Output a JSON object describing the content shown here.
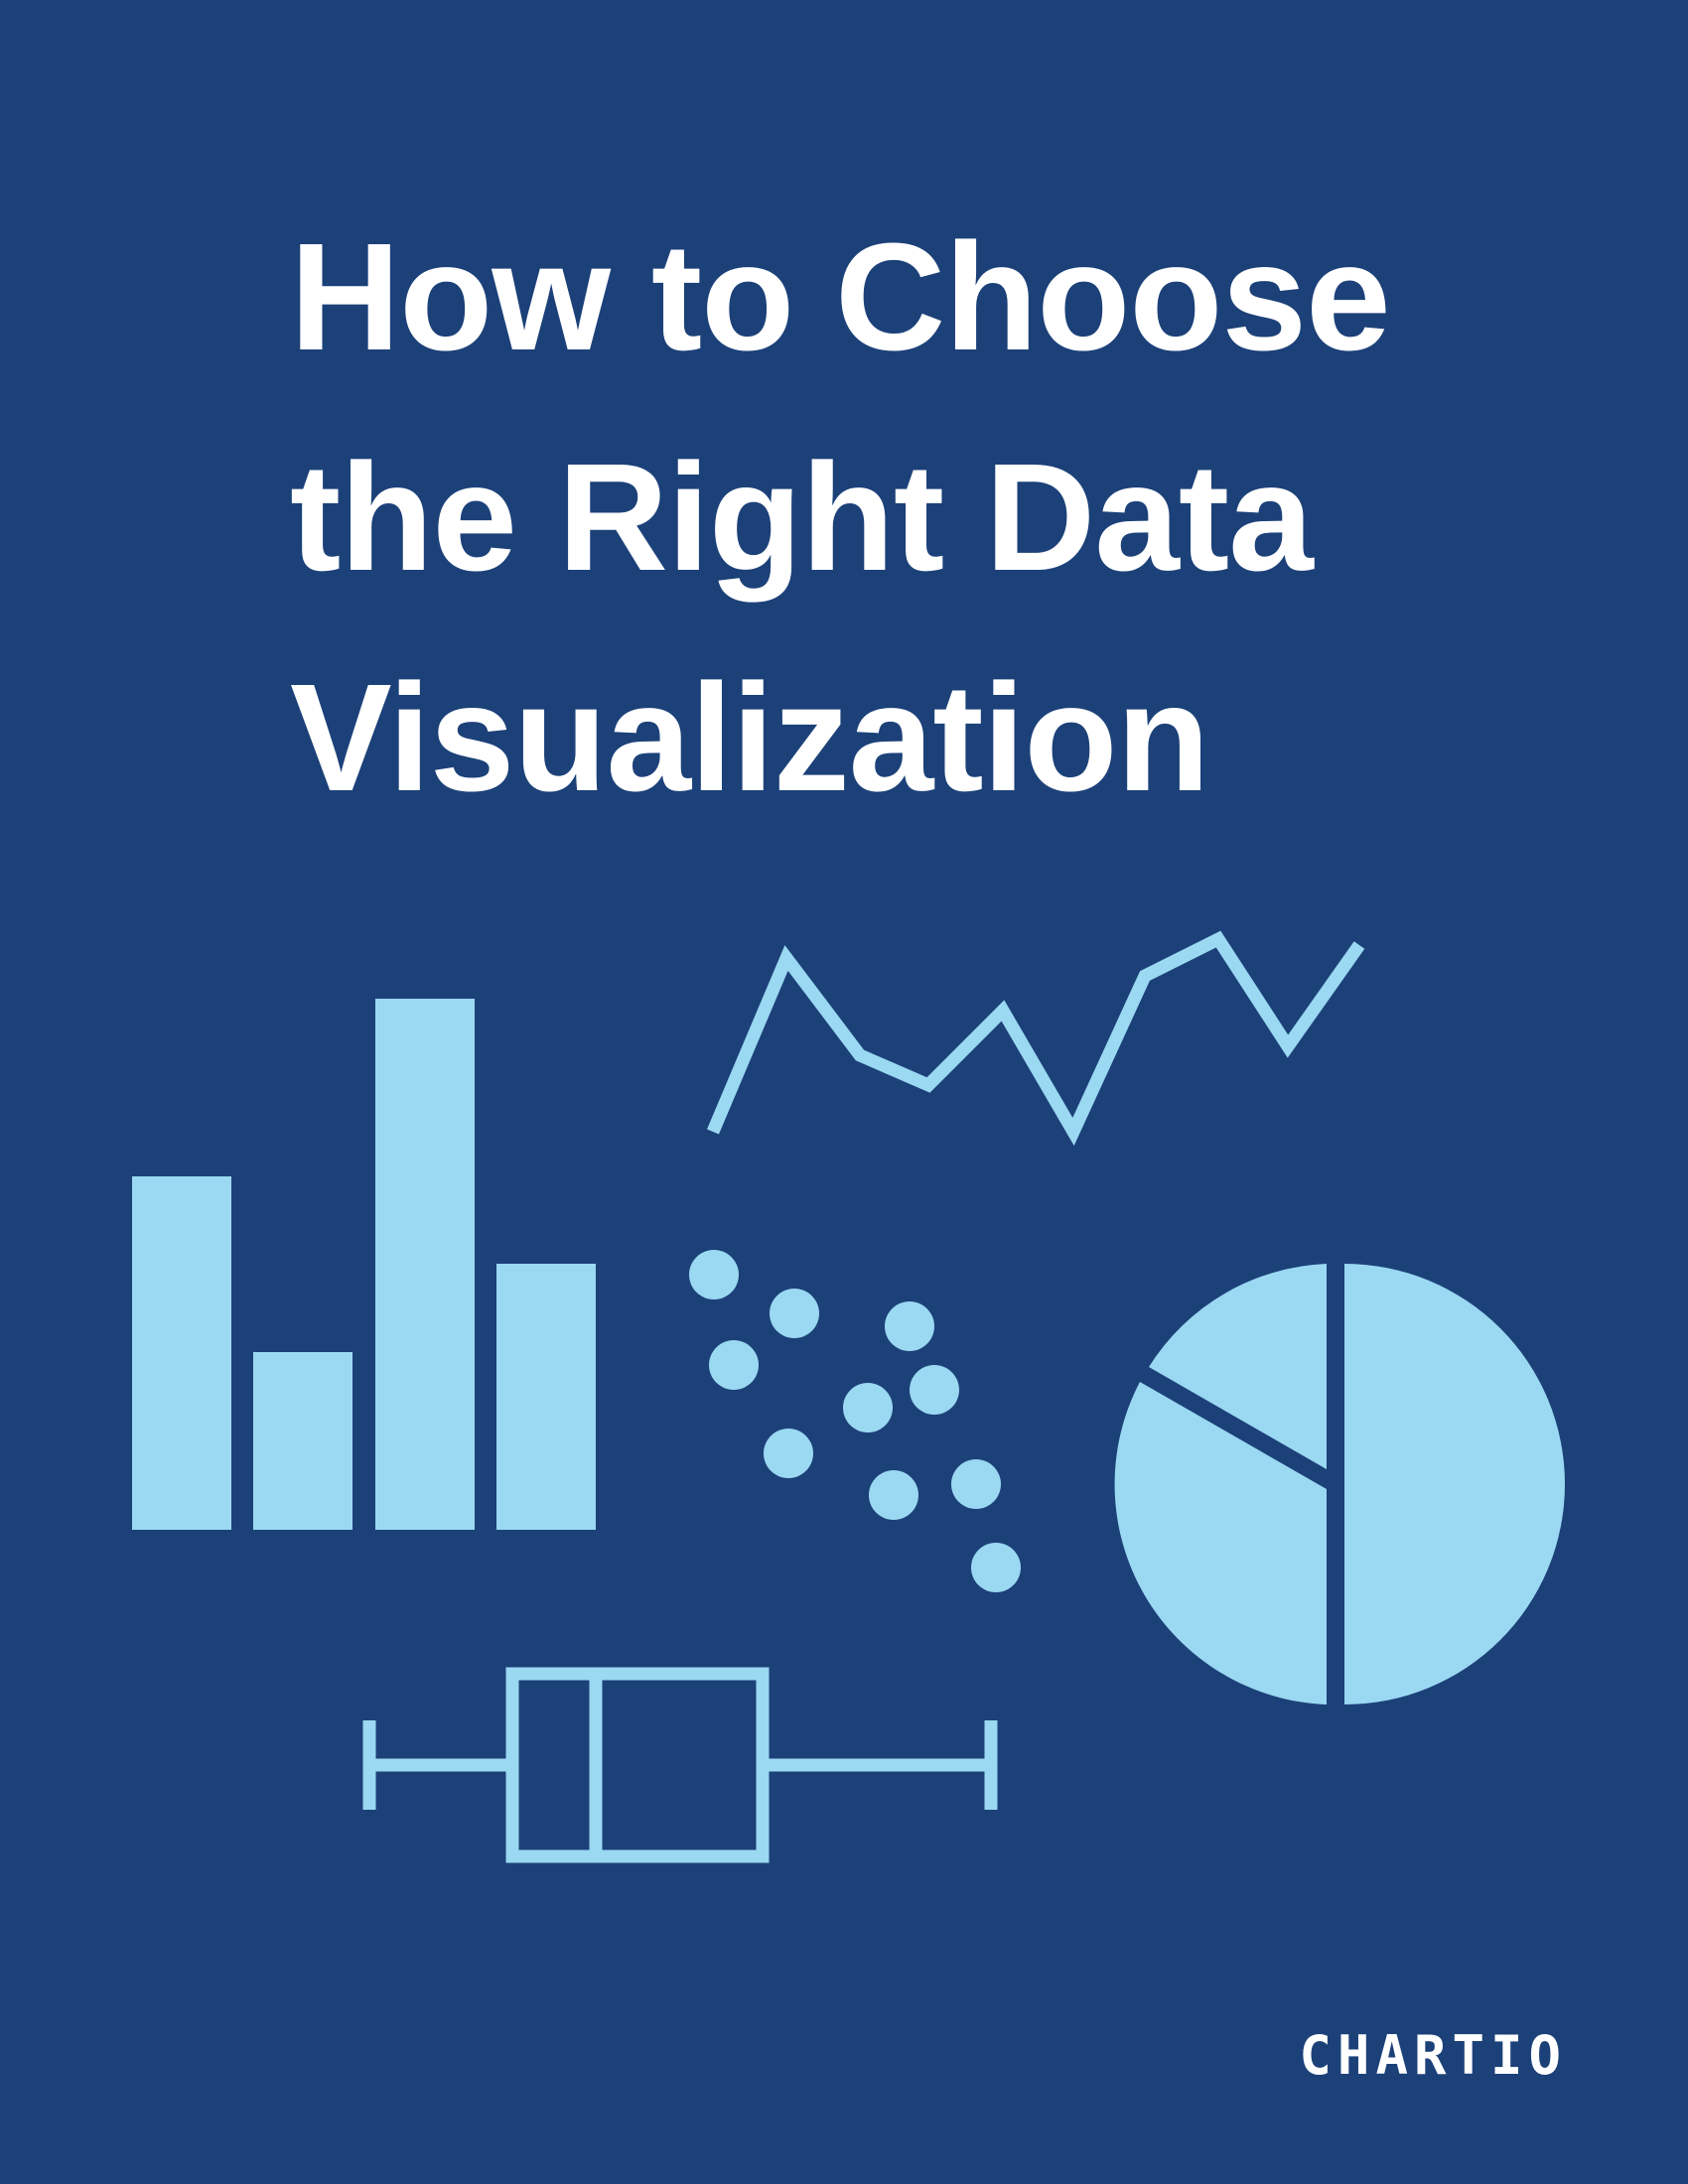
{
  "cover": {
    "title_lines": [
      "How to Choose",
      "the Right Data",
      "Visualization"
    ],
    "brand": "CHARTIO"
  },
  "illustration": {
    "accent_color": "#9bd8f2",
    "background_color": "#1c4179",
    "icons": [
      "bar-chart-icon",
      "line-chart-icon",
      "scatter-plot-icon",
      "pie-chart-icon",
      "box-plot-icon"
    ]
  }
}
